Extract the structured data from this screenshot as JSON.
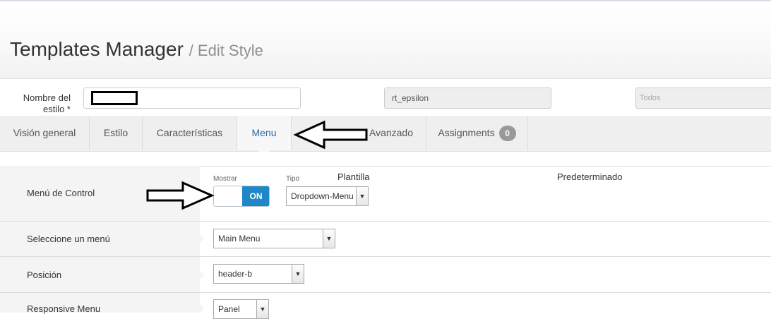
{
  "header": {
    "title": "Templates Manager",
    "subtitle": "/ Edit Style"
  },
  "form": {
    "style_name_label_line1": "Nombre del",
    "style_name_label_line2": "estilo *",
    "style_name_value": "",
    "template_label": "Plantilla",
    "template_value": "rt_epsilon",
    "default_label": "Predeterminado",
    "default_value": "Todos"
  },
  "tabs": [
    {
      "label": "Visión general"
    },
    {
      "label": "Estilo"
    },
    {
      "label": "Características"
    },
    {
      "label": "Menu",
      "active": true
    },
    {
      "label": "Avanzado"
    },
    {
      "label": "Assignments",
      "badge": "0"
    }
  ],
  "settings": {
    "control_menu": {
      "label": "Menú de Control",
      "show_label": "Mostrar",
      "toggle_state": "ON",
      "type_label": "Tipo",
      "type_value": "Dropdown-Menu"
    },
    "select_menu": {
      "label": "Seleccione un menú",
      "value": "Main Menu"
    },
    "position": {
      "label": "Posición",
      "value": "header-b"
    },
    "responsive_menu": {
      "label": "Responsive Menu",
      "value": "Panel"
    }
  },
  "colors": {
    "accent_blue": "#1e87c7",
    "active_tab_text": "#2a6ea6",
    "badge_gray": "#999999"
  },
  "icons": {
    "dropdown": "chevron-down-icon",
    "annotation": "arrow-icon"
  }
}
